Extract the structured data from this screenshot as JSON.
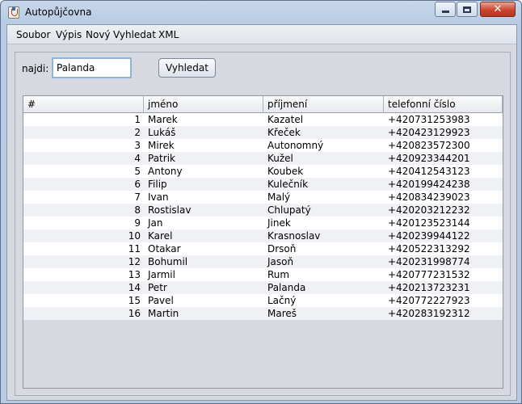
{
  "window": {
    "title": "Autopůjčovna"
  },
  "menu": [
    "Soubor",
    "Výpis",
    "Nový",
    "Vyhledat",
    "XML"
  ],
  "search": {
    "label": "najdi:",
    "value": "Palanda",
    "button": "Vyhledat"
  },
  "table": {
    "headers": [
      "#",
      "jméno",
      "příjmení",
      "telefonní číslo"
    ],
    "rows": [
      [
        "1",
        "Marek",
        "Kazatel",
        "+420731253983"
      ],
      [
        "2",
        "Lukáš",
        "Křeček",
        "+420423129923"
      ],
      [
        "3",
        "Mirek",
        "Autonomný",
        "+420823572300"
      ],
      [
        "4",
        "Patrik",
        "Kužel",
        "+420923344201"
      ],
      [
        "5",
        "Antony",
        "Koubek",
        "+420412543123"
      ],
      [
        "6",
        "Filip",
        "Kulečník",
        "+420199424238"
      ],
      [
        "7",
        "Ivan",
        "Malý",
        "+420834239023"
      ],
      [
        "8",
        "Rostislav",
        "Chlupatý",
        "+420203212232"
      ],
      [
        "9",
        "Jan",
        "Jinek",
        "+420123523144"
      ],
      [
        "10",
        "Karel",
        "Krasnoslav",
        "+420239944122"
      ],
      [
        "11",
        "Otakar",
        "Drsoň",
        "+420522313292"
      ],
      [
        "12",
        "Bohumil",
        "Jasoň",
        "+420231998774"
      ],
      [
        "13",
        "Jarmil",
        "Rum",
        "+420777231532"
      ],
      [
        "14",
        "Petr",
        "Palanda",
        "+420213723231"
      ],
      [
        "15",
        "Pavel",
        "Lačný",
        "+420772227923"
      ],
      [
        "16",
        "Martin",
        "Mareš",
        "+420283192312"
      ]
    ]
  }
}
